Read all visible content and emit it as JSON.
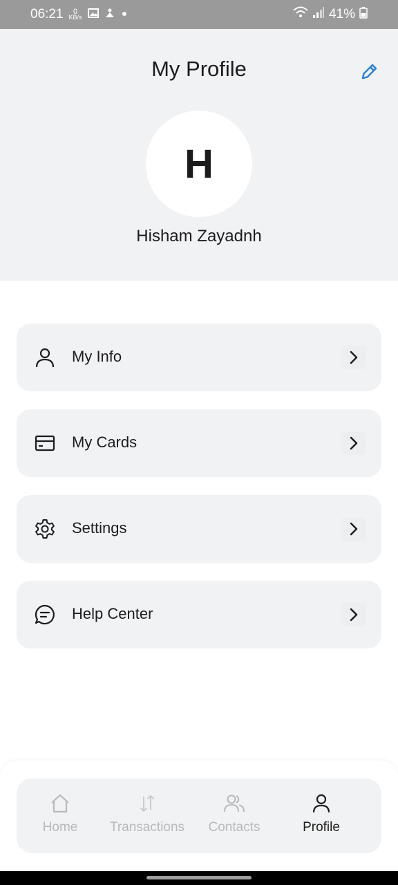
{
  "status_bar": {
    "time": "06:21",
    "net_speed_value": "0",
    "net_speed_unit": "KB/s",
    "battery": "41%",
    "icons": [
      "gallery-icon",
      "app-icon",
      "dot-icon",
      "wifi-icon",
      "signal-icon",
      "battery-icon"
    ]
  },
  "header": {
    "title": "My Profile",
    "avatar_initial": "H",
    "user_name": "Hisham Zayadnh",
    "edit_icon": "pencil-icon",
    "accent_color": "#2f84d6"
  },
  "menu": {
    "items": [
      {
        "label": "My Info",
        "icon": "person-icon"
      },
      {
        "label": "My Cards",
        "icon": "card-icon"
      },
      {
        "label": "Settings",
        "icon": "gear-icon"
      },
      {
        "label": "Help Center",
        "icon": "chat-icon"
      }
    ]
  },
  "nav": {
    "items": [
      {
        "label": "Home",
        "icon": "home-icon",
        "active": false
      },
      {
        "label": "Transactions",
        "icon": "transfer-icon",
        "active": false
      },
      {
        "label": "Contacts",
        "icon": "contacts-icon",
        "active": false
      },
      {
        "label": "Profile",
        "icon": "person-icon",
        "active": true
      }
    ]
  }
}
